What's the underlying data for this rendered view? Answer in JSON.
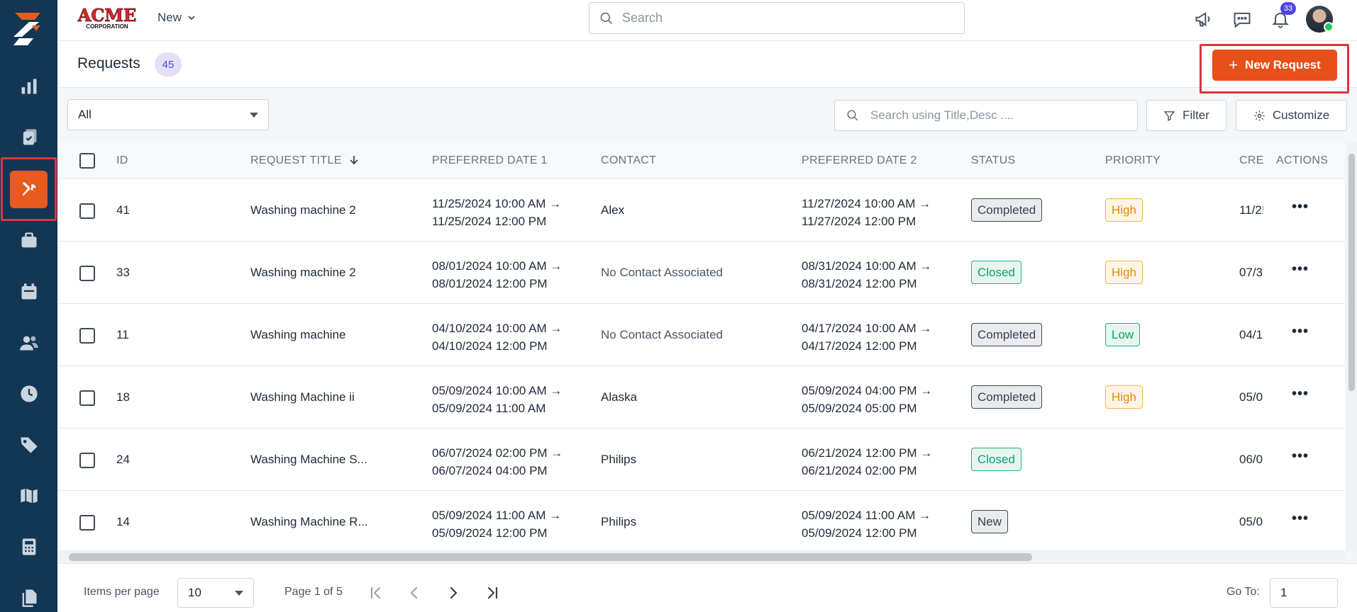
{
  "topbar": {
    "brand_name": "ACME",
    "brand_sub": "CORPORATION",
    "new_menu_label": "New",
    "search_placeholder": "Search",
    "notifications_count": "33"
  },
  "page": {
    "title": "Requests",
    "count": "45",
    "new_request_label": "New Request"
  },
  "filters": {
    "view_selected": "All",
    "search_placeholder": "Search using Title,Desc ....",
    "filter_label": "Filter",
    "customize_label": "Customize"
  },
  "table": {
    "columns": {
      "id": "ID",
      "title": "REQUEST TITLE",
      "date1": "PREFERRED DATE 1",
      "contact": "CONTACT",
      "date2": "PREFERRED DATE 2",
      "status": "STATUS",
      "priority": "PRIORITY",
      "created": "CRE",
      "actions": "ACTIONS"
    },
    "rows": [
      {
        "id": "41",
        "title": "Washing machine 2",
        "d1a": "11/25/2024 10:00 AM →",
        "d1b": "11/25/2024 12:00 PM",
        "contact": "Alex",
        "d2a": "11/27/2024 10:00 AM →",
        "d2b": "11/27/2024 12:00 PM",
        "status": "Completed",
        "priority": "High",
        "created": "11/2!"
      },
      {
        "id": "33",
        "title": "Washing machine 2",
        "d1a": "08/01/2024 10:00 AM →",
        "d1b": "08/01/2024 12:00 PM",
        "contact": "No Contact Associated",
        "d2a": "08/31/2024 10:00 AM →",
        "d2b": "08/31/2024 12:00 PM",
        "status": "Closed",
        "priority": "High",
        "created": "07/3"
      },
      {
        "id": "11",
        "title": "Washing machine",
        "d1a": "04/10/2024 10:00 AM →",
        "d1b": "04/10/2024 12:00 PM",
        "contact": "No Contact Associated",
        "d2a": "04/17/2024 10:00 AM →",
        "d2b": "04/17/2024 12:00 PM",
        "status": "Completed",
        "priority": "Low",
        "created": "04/1"
      },
      {
        "id": "18",
        "title": "Washing Machine ii",
        "d1a": "05/09/2024 10:00 AM →",
        "d1b": "05/09/2024 11:00 AM",
        "contact": "Alaska",
        "d2a": "05/09/2024 04:00 PM →",
        "d2b": "05/09/2024 05:00 PM",
        "status": "Completed",
        "priority": "High",
        "created": "05/0"
      },
      {
        "id": "24",
        "title": "Washing Machine S...",
        "d1a": "06/07/2024 02:00 PM →",
        "d1b": "06/07/2024 04:00 PM",
        "contact": "Philips",
        "d2a": "06/21/2024 12:00 PM →",
        "d2b": "06/21/2024 02:00 PM",
        "status": "Closed",
        "priority": "",
        "created": "06/0"
      },
      {
        "id": "14",
        "title": "Washing Machine R...",
        "d1a": "05/09/2024 11:00 AM →",
        "d1b": "05/09/2024 12:00 PM",
        "contact": "Philips",
        "d2a": "05/09/2024 11:00 AM →",
        "d2b": "05/09/2024 12:00 PM",
        "status": "New",
        "priority": "",
        "created": "05/0"
      }
    ]
  },
  "pagination": {
    "items_per_page_label": "Items per page",
    "items_per_page_value": "10",
    "page_info": "Page 1 of 5",
    "goto_label": "Go To:",
    "goto_value": "1"
  },
  "colors": {
    "sidebar": "#123654",
    "accent": "#e8501a",
    "highlight": "#d9363e",
    "badge": "#4f46e5"
  },
  "icons": {
    "sidebar": [
      "dashboard-icon",
      "work-orders-icon",
      "requests-icon",
      "assets-icon",
      "calendar-icon",
      "people-icon",
      "time-icon",
      "tags-icon",
      "map-icon",
      "calculator-icon",
      "files-icon"
    ],
    "topbar": [
      "megaphone-icon",
      "chat-icon",
      "bell-icon",
      "avatar"
    ]
  }
}
